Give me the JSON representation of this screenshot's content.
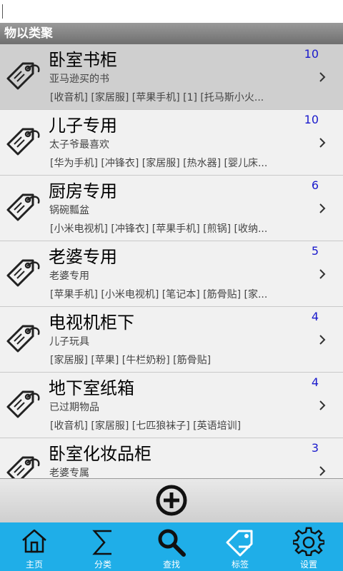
{
  "header": {
    "title": "物以类聚"
  },
  "items": [
    {
      "title": "卧室书柜",
      "subtitle": "亚马逊买的书",
      "tags": "[收音机] [家居服] [苹果手机] [1] [托马斯小火...",
      "count": "10",
      "selected": true
    },
    {
      "title": "儿子专用",
      "subtitle": "太子爷最喜欢",
      "tags": "[华为手机] [冲锋衣] [家居服] [热水器] [婴儿床...",
      "count": "10",
      "selected": false
    },
    {
      "title": "厨房专用",
      "subtitle": "锅碗瓢盆",
      "tags": "[小米电视机] [冲锋衣] [苹果手机] [煎锅] [收纳...",
      "count": "6",
      "selected": false
    },
    {
      "title": "老婆专用",
      "subtitle": "老婆专用",
      "tags": "[苹果手机] [小米电视机] [笔记本] [筋骨贴] [家...",
      "count": "5",
      "selected": false
    },
    {
      "title": "电视机柜下",
      "subtitle": "儿子玩具",
      "tags": "[家居服] [苹果] [牛栏奶粉] [筋骨贴]",
      "count": "4",
      "selected": false
    },
    {
      "title": "地下室纸箱",
      "subtitle": "已过期物品",
      "tags": "[收音机] [家居服] [七匹狼袜子] [英语培训]",
      "count": "4",
      "selected": false
    },
    {
      "title": "卧室化妆品柜",
      "subtitle": "老婆专属",
      "tags": "",
      "count": "3",
      "selected": false
    }
  ],
  "tabs": [
    {
      "label": "主页",
      "icon": "home-icon"
    },
    {
      "label": "分类",
      "icon": "sigma-icon"
    },
    {
      "label": "查找",
      "icon": "search-icon"
    },
    {
      "label": "标签",
      "icon": "tag-icon"
    },
    {
      "label": "设置",
      "icon": "gear-icon"
    }
  ],
  "colors": {
    "tabbar": "#1faee8",
    "count": "#1a1acc",
    "header": "#7f7f7f"
  }
}
